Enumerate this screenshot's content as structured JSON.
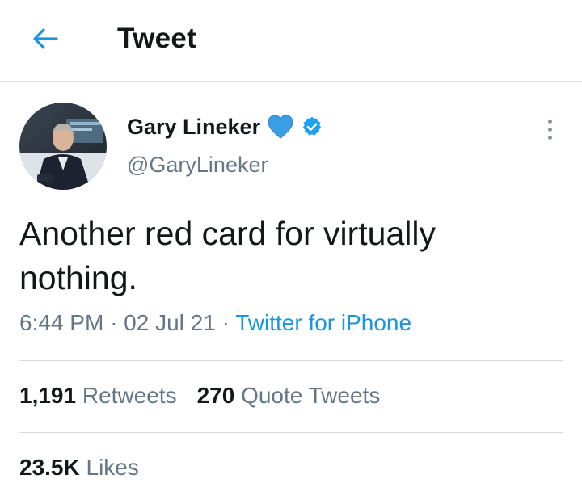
{
  "header": {
    "title": "Tweet"
  },
  "author": {
    "display_name": "Gary Lineker",
    "emoji": "💙",
    "handle": "@GaryLineker"
  },
  "tweet": {
    "text": "Another red card for virtually nothing.",
    "time": "6:44 PM",
    "date": "02 Jul 21",
    "separator": "·",
    "source": "Twitter for iPhone"
  },
  "stats": {
    "retweets": {
      "count": "1,191",
      "label": "Retweets"
    },
    "quote_tweets": {
      "count": "270",
      "label": "Quote Tweets"
    },
    "likes": {
      "count": "23.5K",
      "label": "Likes"
    }
  },
  "colors": {
    "accent": "#1b95e0",
    "secondary_text": "#657786",
    "primary_text": "#14171a",
    "divider": "#d9dde0"
  }
}
